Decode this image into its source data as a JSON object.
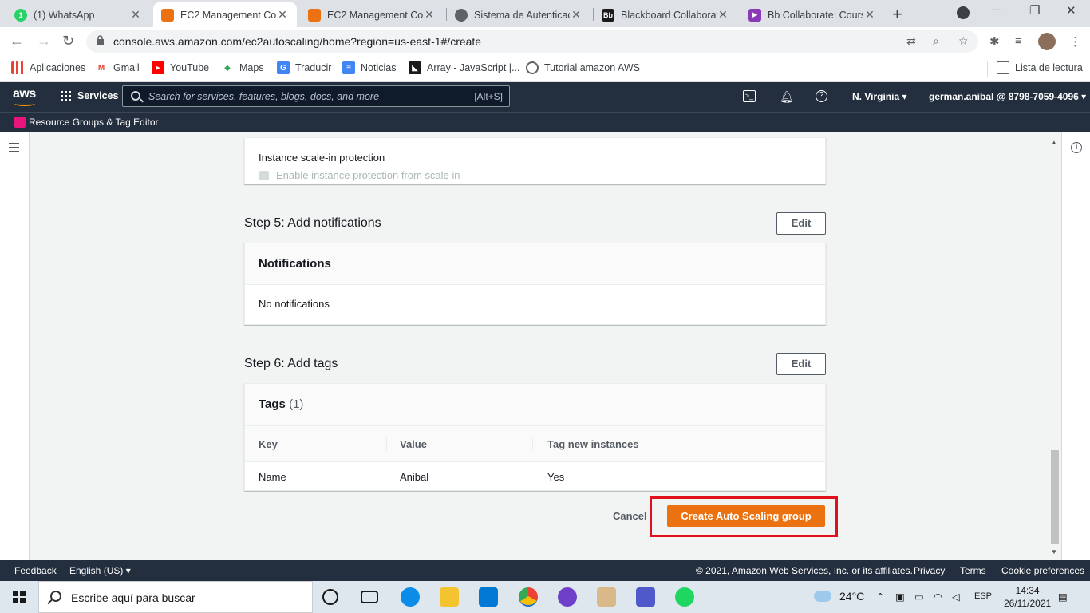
{
  "browser": {
    "tabs": [
      {
        "title": "(1) WhatsApp",
        "active": false
      },
      {
        "title": "EC2 Management Con",
        "active": true
      },
      {
        "title": "EC2 Management Con",
        "active": false
      },
      {
        "title": "Sistema de Autenticac",
        "active": false
      },
      {
        "title": "Blackboard Collaborat",
        "active": false
      },
      {
        "title": "Bb Collaborate: Cours",
        "active": false
      }
    ],
    "url": "console.aws.amazon.com/ec2autoscaling/home?region=us-east-1#/create",
    "bookmarks": [
      "Aplicaciones",
      "Gmail",
      "YouTube",
      "Maps",
      "Traducir",
      "Noticias",
      "Array - JavaScript |...",
      "Tutorial amazon AWS"
    ],
    "reading_list": "Lista de lectura"
  },
  "aws": {
    "logo": "aws",
    "services": "Services",
    "search_placeholder": "Search for services, features, blogs, docs, and more",
    "search_shortcut": "[Alt+S]",
    "region": "N. Virginia ▾",
    "account": "german.anibal @ 8798-7059-4096 ▾",
    "resource_groups": "Resource Groups & Tag Editor"
  },
  "scale_in": {
    "label": "Instance scale-in protection",
    "checkbox_label": "Enable instance protection from scale in"
  },
  "step5": {
    "title": "Step 5: Add notifications",
    "edit": "Edit",
    "panel_title": "Notifications",
    "body": "No notifications"
  },
  "step6": {
    "title": "Step 6: Add tags",
    "edit": "Edit",
    "panel_title": "Tags",
    "count": "(1)",
    "columns": [
      "Key",
      "Value",
      "Tag new instances"
    ],
    "rows": [
      [
        "Name",
        "Anibal",
        "Yes"
      ]
    ]
  },
  "actions": {
    "cancel": "Cancel",
    "create": "Create Auto Scaling group"
  },
  "footer": {
    "feedback": "Feedback",
    "language": "English (US) ▾",
    "copyright": "© 2021, Amazon Web Services, Inc. or its affiliates.",
    "privacy": "Privacy",
    "terms": "Terms",
    "cookies": "Cookie preferences"
  },
  "taskbar": {
    "search": "Escribe aquí para buscar",
    "weather": "24°C",
    "lang": "ESP",
    "time": "14:34",
    "date": "26/11/2021"
  },
  "colors": {
    "aws_nav": "#232f3e",
    "primary_button": "#ec7211",
    "highlight_border": "#e0101d"
  }
}
